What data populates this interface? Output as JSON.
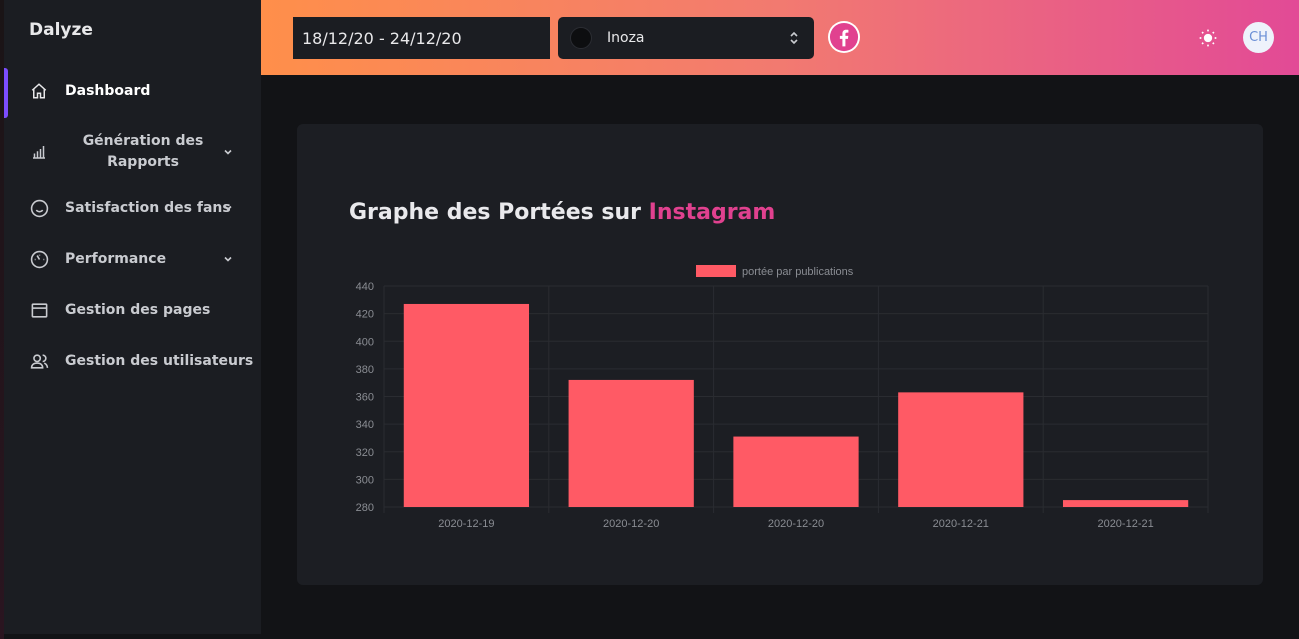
{
  "sidebar": {
    "brand": "Dalyze",
    "items": [
      {
        "label": "Dashboard",
        "icon": "home-icon",
        "active": true
      },
      {
        "label": "Génération des Rapports",
        "icon": "bar-chart-icon",
        "expandable": true
      },
      {
        "label": "Satisfaction des fans",
        "icon": "smile-icon",
        "expandable": true
      },
      {
        "label": "Performance",
        "icon": "gauge-icon",
        "expandable": true
      },
      {
        "label": "Gestion des pages",
        "icon": "window-icon"
      },
      {
        "label": "Gestion des utilisateurs",
        "icon": "users-icon"
      }
    ]
  },
  "header": {
    "date_range": "18/12/20 - 24/12/20",
    "page_select": "Inoza",
    "network_icon": "facebook-icon",
    "theme_icon": "sun-icon",
    "user_initials": "CH"
  },
  "colors": {
    "accent": "#e1418f",
    "bar": "#ff5a65",
    "active_indicator": "#7c4dff"
  },
  "card": {
    "title_prefix": "Graphe des Portées sur",
    "title_accent": "Instagram"
  },
  "chart_data": {
    "type": "bar",
    "categories": [
      "2020-12-19",
      "2020-12-20",
      "2020-12-20",
      "2020-12-21",
      "2020-12-21"
    ],
    "series": [
      {
        "name": "portée par publications",
        "values": [
          427,
          372,
          331,
          363,
          285
        ]
      }
    ],
    "ylim": [
      280,
      440
    ],
    "yticks": [
      280,
      300,
      320,
      340,
      360,
      380,
      400,
      420,
      440
    ],
    "legend": "top",
    "grid": true
  }
}
